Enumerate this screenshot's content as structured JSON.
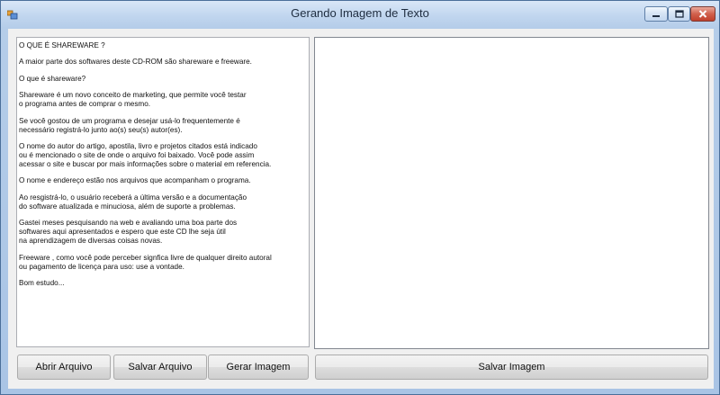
{
  "window": {
    "title": "Gerando Imagem de Texto"
  },
  "text_editor": {
    "paragraphs": [
      "O QUE É SHAREWARE ?",
      "A maior parte dos softwares deste CD-ROM são shareware e freeware.",
      "O que é shareware?",
      "Shareware é um novo conceito de marketing, que permite você testar\no programa antes de comprar o mesmo.",
      "Se você gostou de um programa e desejar usá-lo frequentemente é\nnecessário registrá-lo junto ao(s) seu(s) autor(es).",
      "O nome do autor do artigo, apostila, livro e projetos citados está indicado\nou é mencionado o site de onde o arquivo foi baixado. Você pode assim\nacessar o site e buscar por mais informações sobre o material em referencia.",
      "O nome e endereço estão nos arquivos que acompanham o programa.",
      "Ao resgistrá-lo, o usuário receberá a última versão e a documentação\ndo software atualizada e minuciosa, além de suporte a problemas.",
      "Gastei meses pesquisando na web e avaliando uma boa parte dos\nsoftwares aqui apresentados e espero que este CD lhe seja útil\nna aprendizagem de diversas coisas novas.",
      "Freeware , como você pode perceber signfica livre de qualquer direito autoral\nou pagamento de licença para uso: use a vontade.",
      "Bom estudo..."
    ]
  },
  "buttons": {
    "open": "Abrir Arquivo",
    "save_file": "Salvar Arquivo",
    "generate": "Gerar Imagem",
    "save_image": "Salvar Imagem"
  }
}
